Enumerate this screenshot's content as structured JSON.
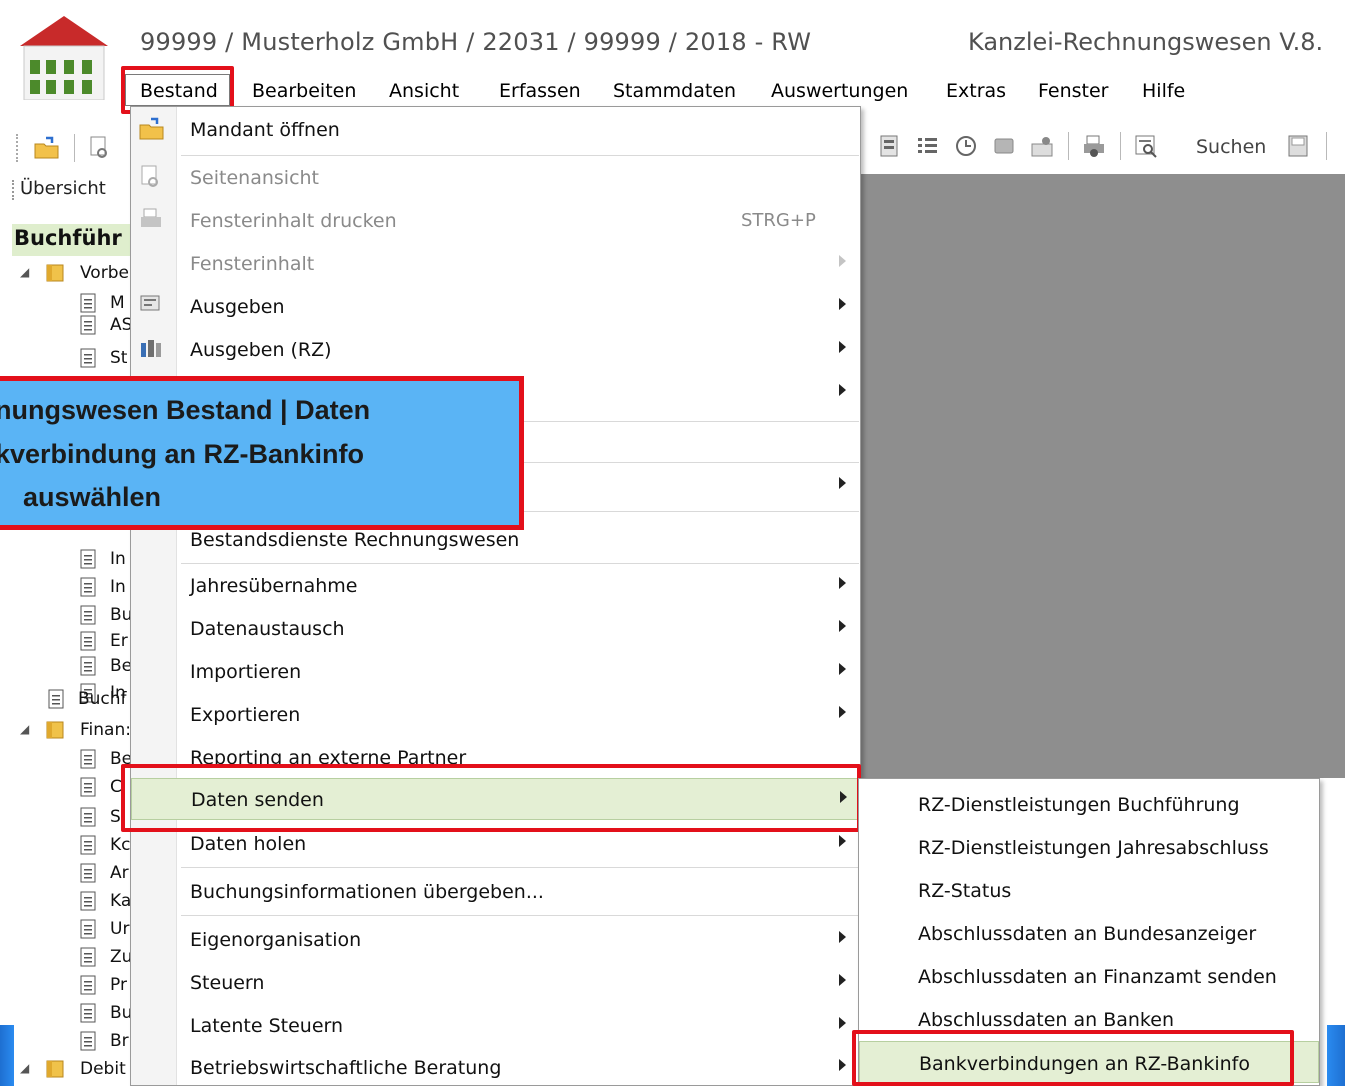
{
  "window": {
    "title": "99999 / Musterholz GmbH / 22031 / 99999 / 2018 - RW",
    "title_right": "Kanzlei-Rechnungswesen V.8."
  },
  "menubar": {
    "items": [
      "Bestand",
      "Bearbeiten",
      "Ansicht",
      "Erfassen",
      "Stammdaten",
      "Auswertungen",
      "Extras",
      "Fenster",
      "Hilfe"
    ]
  },
  "toolbar": {
    "search_label": "Suchen"
  },
  "sidebar": {
    "tab_label": "Übersicht",
    "section_title": "Buchführ",
    "tree": [
      "Vorbe",
      "M",
      "AS",
      "St",
      "In",
      "In",
      "Bu",
      "Er",
      "Be",
      "In",
      "Buchf",
      "Finan:",
      "Be",
      "C",
      "S",
      "Kc",
      "Ar",
      "Ka",
      "Ur",
      "Zu",
      "Pr",
      "Bu",
      "Br",
      "Debit"
    ]
  },
  "dropdown": {
    "items": [
      {
        "label": "Mandant öffnen",
        "icon": "folder-open-icon"
      },
      {
        "label": "Seitenansicht",
        "icon": "page-preview-icon"
      },
      {
        "label": "Fensterinhalt drucken",
        "shortcut": "STRG+P",
        "icon": "printer-icon"
      },
      {
        "label": "Fensterinhalt"
      },
      {
        "label": "Ausgeben",
        "icon": "output-icon"
      },
      {
        "label": "Ausgeben (RZ)",
        "icon": "output-rz-icon"
      },
      {
        "label": "Bestandsdienste Rechnungswesen"
      },
      {
        "label": "Jahresübernahme"
      },
      {
        "label": "Datenaustausch"
      },
      {
        "label": "Importieren"
      },
      {
        "label": "Exportieren"
      },
      {
        "label": "Reporting an externe Partner"
      },
      {
        "label": "Daten senden"
      },
      {
        "label": "Daten holen"
      },
      {
        "label": "Buchungsinformationen übergeben..."
      },
      {
        "label": "Eigenorganisation"
      },
      {
        "label": "Steuern"
      },
      {
        "label": "Latente Steuern"
      },
      {
        "label": "Betriebswirtschaftliche Beratung"
      }
    ]
  },
  "submenu": {
    "items": [
      "RZ-Dienstleistungen Buchführung",
      "RZ-Dienstleistungen Jahresabschluss",
      "RZ-Status",
      "Abschlussdaten an Bundesanzeiger",
      "Abschlussdaten an Finanzamt senden",
      "Abschlussdaten an Banken",
      "Bankverbindungen an RZ-Bankinfo"
    ]
  },
  "callout": {
    "line1": "nungswesen Bestand | Daten",
    "line2": "kverbindung an RZ-Bankinfo",
    "line3": "auswählen"
  },
  "colors": {
    "highlight": "#e4efd4",
    "annotation_red": "#e3101a",
    "callout_blue": "#5ab4f5",
    "workspace_gray": "#8e8e8e"
  }
}
